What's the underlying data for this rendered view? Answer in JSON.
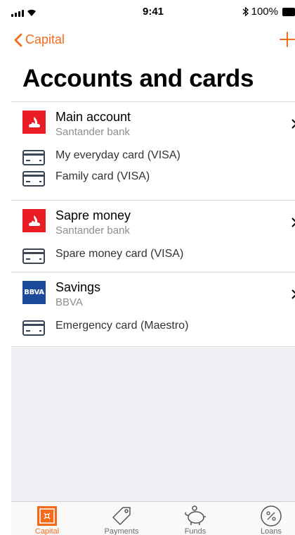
{
  "status_bar": {
    "time": "9:41",
    "battery": "100%"
  },
  "nav": {
    "back_label": "Capital",
    "add_icon": "plus-icon"
  },
  "page_title": "Accounts and cards",
  "accounts": [
    {
      "name": "Main account",
      "bank": "Santander bank",
      "logo": "santander-logo",
      "cards": [
        "My everyday card (VISA)",
        "Family card (VISA)"
      ]
    },
    {
      "name": "Sapre money",
      "bank": "Santander bank",
      "logo": "santander-logo",
      "cards": [
        "Spare money card (VISA)"
      ]
    },
    {
      "name": "Savings",
      "bank": "BBVA",
      "logo": "bbva-logo",
      "logo_text": "BBVA",
      "cards": [
        "Emergency card (Maestro)"
      ]
    }
  ],
  "tabs": [
    {
      "label": "Capital",
      "icon": "safe-icon",
      "active": true
    },
    {
      "label": "Payments",
      "icon": "tag-icon",
      "active": false
    },
    {
      "label": "Funds",
      "icon": "piggy-bank-icon",
      "active": false
    },
    {
      "label": "Loans",
      "icon": "percent-icon",
      "active": false
    }
  ],
  "colors": {
    "accent": "#f26b1d",
    "santander": "#ea1c24",
    "bbva": "#1a4a99",
    "background_gray": "#efeff4"
  }
}
